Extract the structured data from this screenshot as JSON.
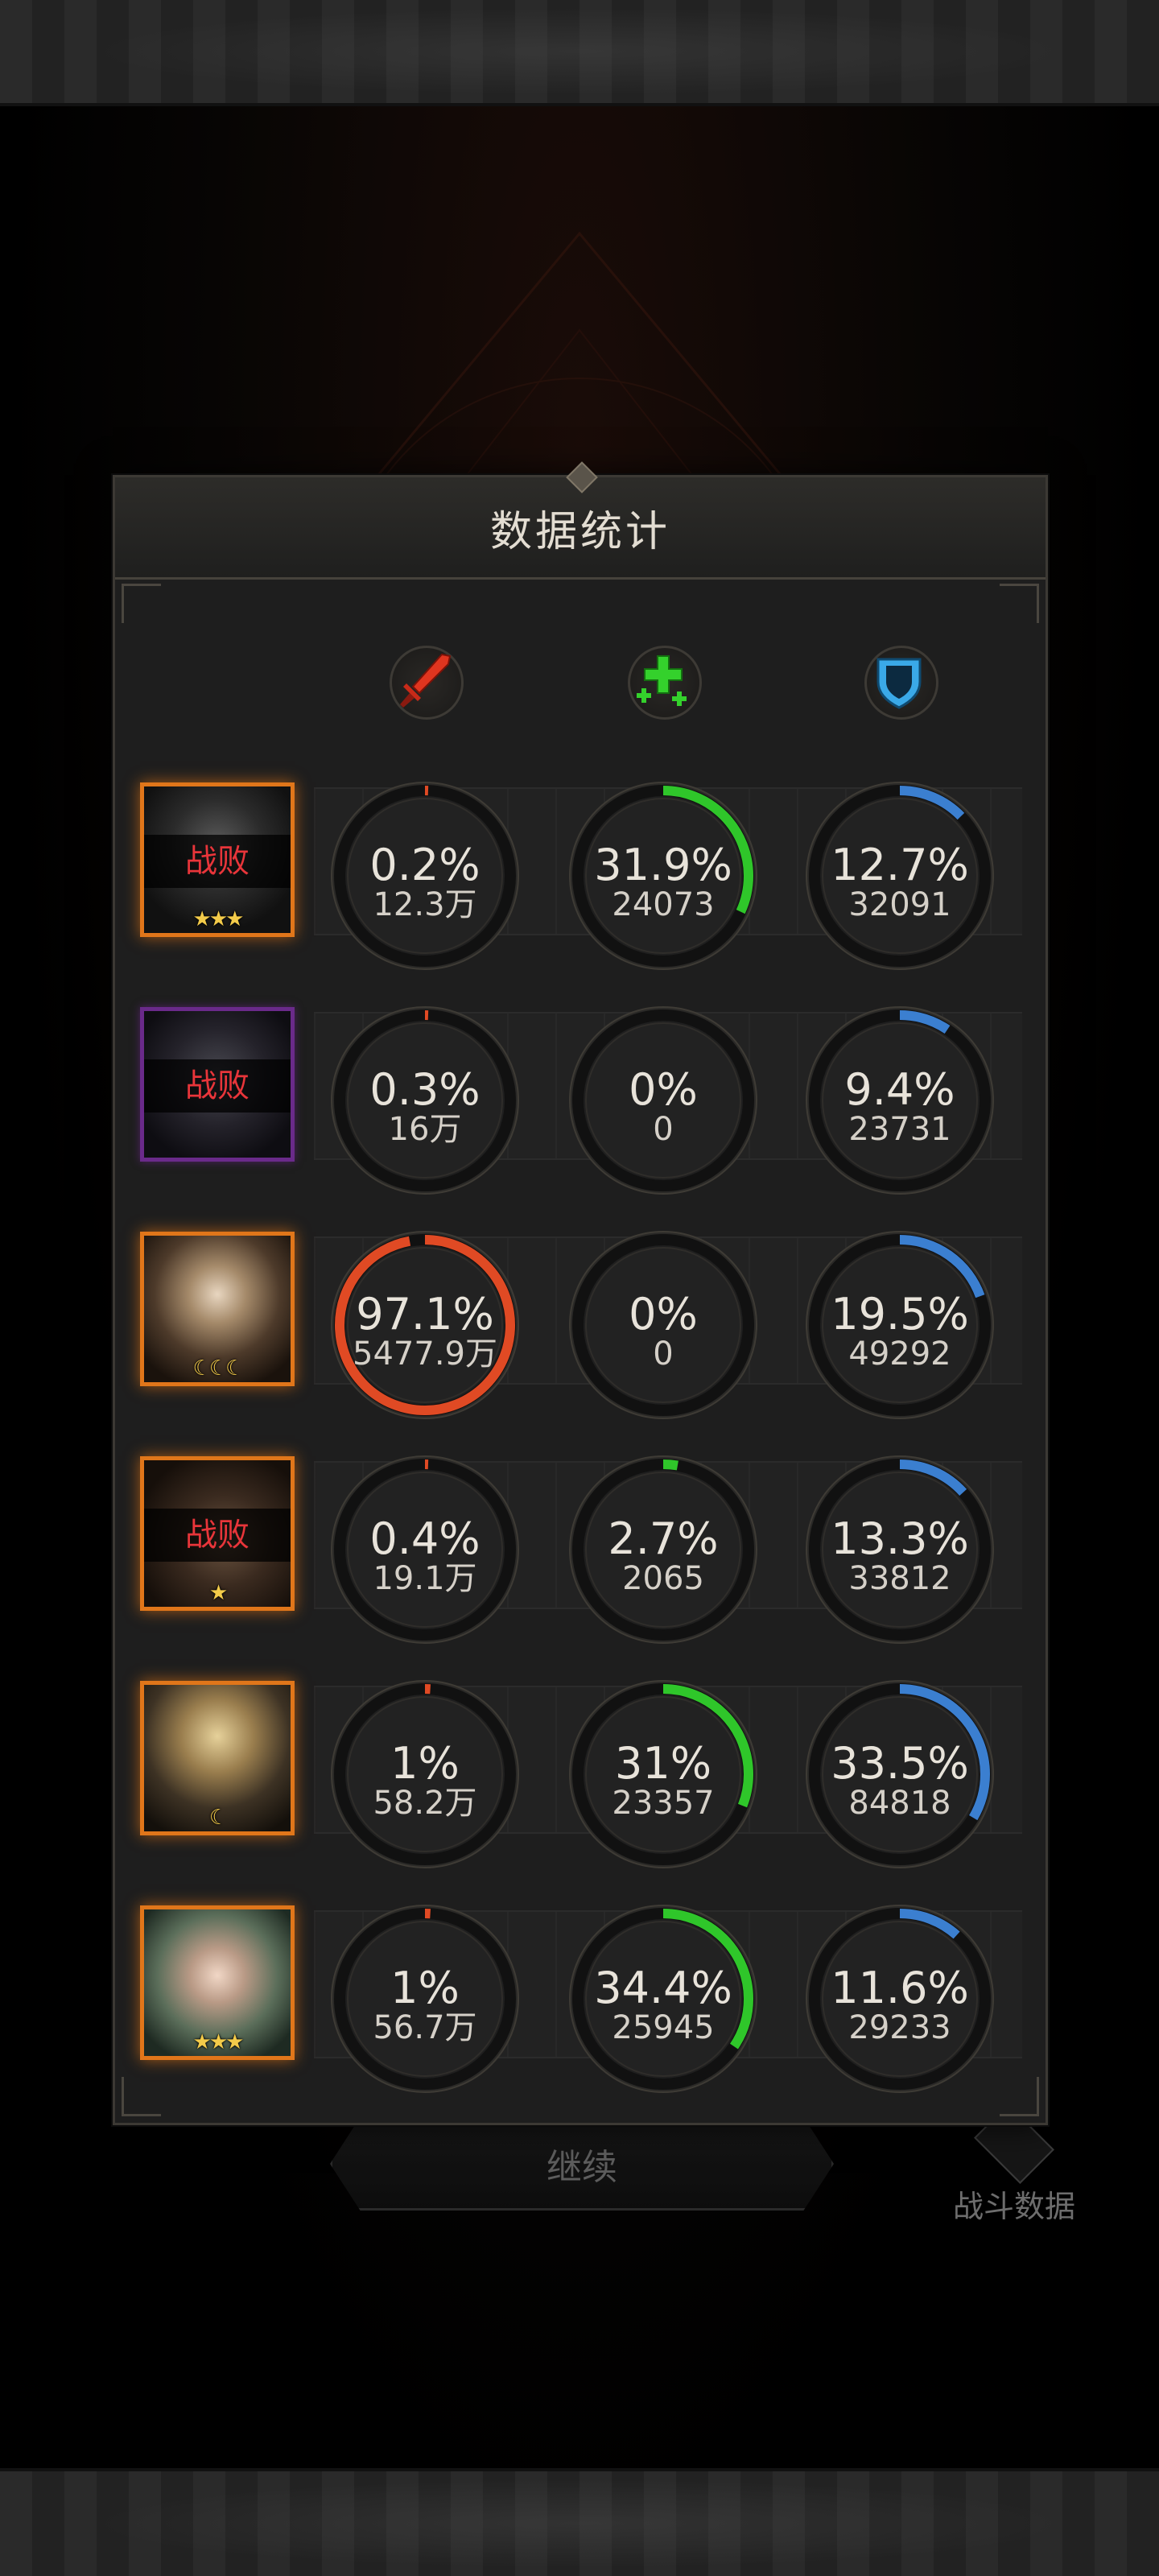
{
  "panel": {
    "title": "数据统计"
  },
  "background": {
    "continue_label": "继续",
    "battle_data_label": "战斗数据"
  },
  "columns": [
    {
      "icon": "sword-icon",
      "color": "#e0351f"
    },
    {
      "icon": "heal-cross-icon",
      "color": "#34d12c"
    },
    {
      "icon": "shield-icon",
      "color": "#3aa9e8"
    }
  ],
  "colors": {
    "damage": "#e04a24",
    "heal": "#2fc62a",
    "tank": "#3b7fd0",
    "frame_orange": "#e0761a",
    "frame_purple": "#6a2a8a",
    "defeated_text": "#e8353a"
  },
  "rows": [
    {
      "defeated": "战败",
      "stars": "★★★",
      "frame": "orange",
      "damage": {
        "percent_label": "0.2%",
        "value": "12.3万",
        "fraction": 0.002
      },
      "heal": {
        "percent_label": "31.9%",
        "value": "24073",
        "fraction": 0.319
      },
      "tank": {
        "percent_label": "12.7%",
        "value": "32091",
        "fraction": 0.127
      }
    },
    {
      "defeated": "战败",
      "stars": "",
      "frame": "purple",
      "damage": {
        "percent_label": "0.3%",
        "value": "16万",
        "fraction": 0.003
      },
      "heal": {
        "percent_label": "0%",
        "value": "0",
        "fraction": 0
      },
      "tank": {
        "percent_label": "9.4%",
        "value": "23731",
        "fraction": 0.094
      }
    },
    {
      "defeated": "",
      "stars": "☾☾☾",
      "frame": "orange",
      "damage": {
        "percent_label": "97.1%",
        "value": "5477.9万",
        "fraction": 0.971
      },
      "heal": {
        "percent_label": "0%",
        "value": "0",
        "fraction": 0
      },
      "tank": {
        "percent_label": "19.5%",
        "value": "49292",
        "fraction": 0.195
      }
    },
    {
      "defeated": "战败",
      "stars": "★",
      "frame": "orange",
      "damage": {
        "percent_label": "0.4%",
        "value": "19.1万",
        "fraction": 0.004
      },
      "heal": {
        "percent_label": "2.7%",
        "value": "2065",
        "fraction": 0.027
      },
      "tank": {
        "percent_label": "13.3%",
        "value": "33812",
        "fraction": 0.133
      }
    },
    {
      "defeated": "",
      "stars": "☾",
      "frame": "orange",
      "damage": {
        "percent_label": "1%",
        "value": "58.2万",
        "fraction": 0.01
      },
      "heal": {
        "percent_label": "31%",
        "value": "23357",
        "fraction": 0.31
      },
      "tank": {
        "percent_label": "33.5%",
        "value": "84818",
        "fraction": 0.335
      }
    },
    {
      "defeated": "",
      "stars": "★★★",
      "frame": "orange",
      "damage": {
        "percent_label": "1%",
        "value": "56.7万",
        "fraction": 0.01
      },
      "heal": {
        "percent_label": "34.4%",
        "value": "25945",
        "fraction": 0.344
      },
      "tank": {
        "percent_label": "11.6%",
        "value": "29233",
        "fraction": 0.116
      }
    }
  ]
}
